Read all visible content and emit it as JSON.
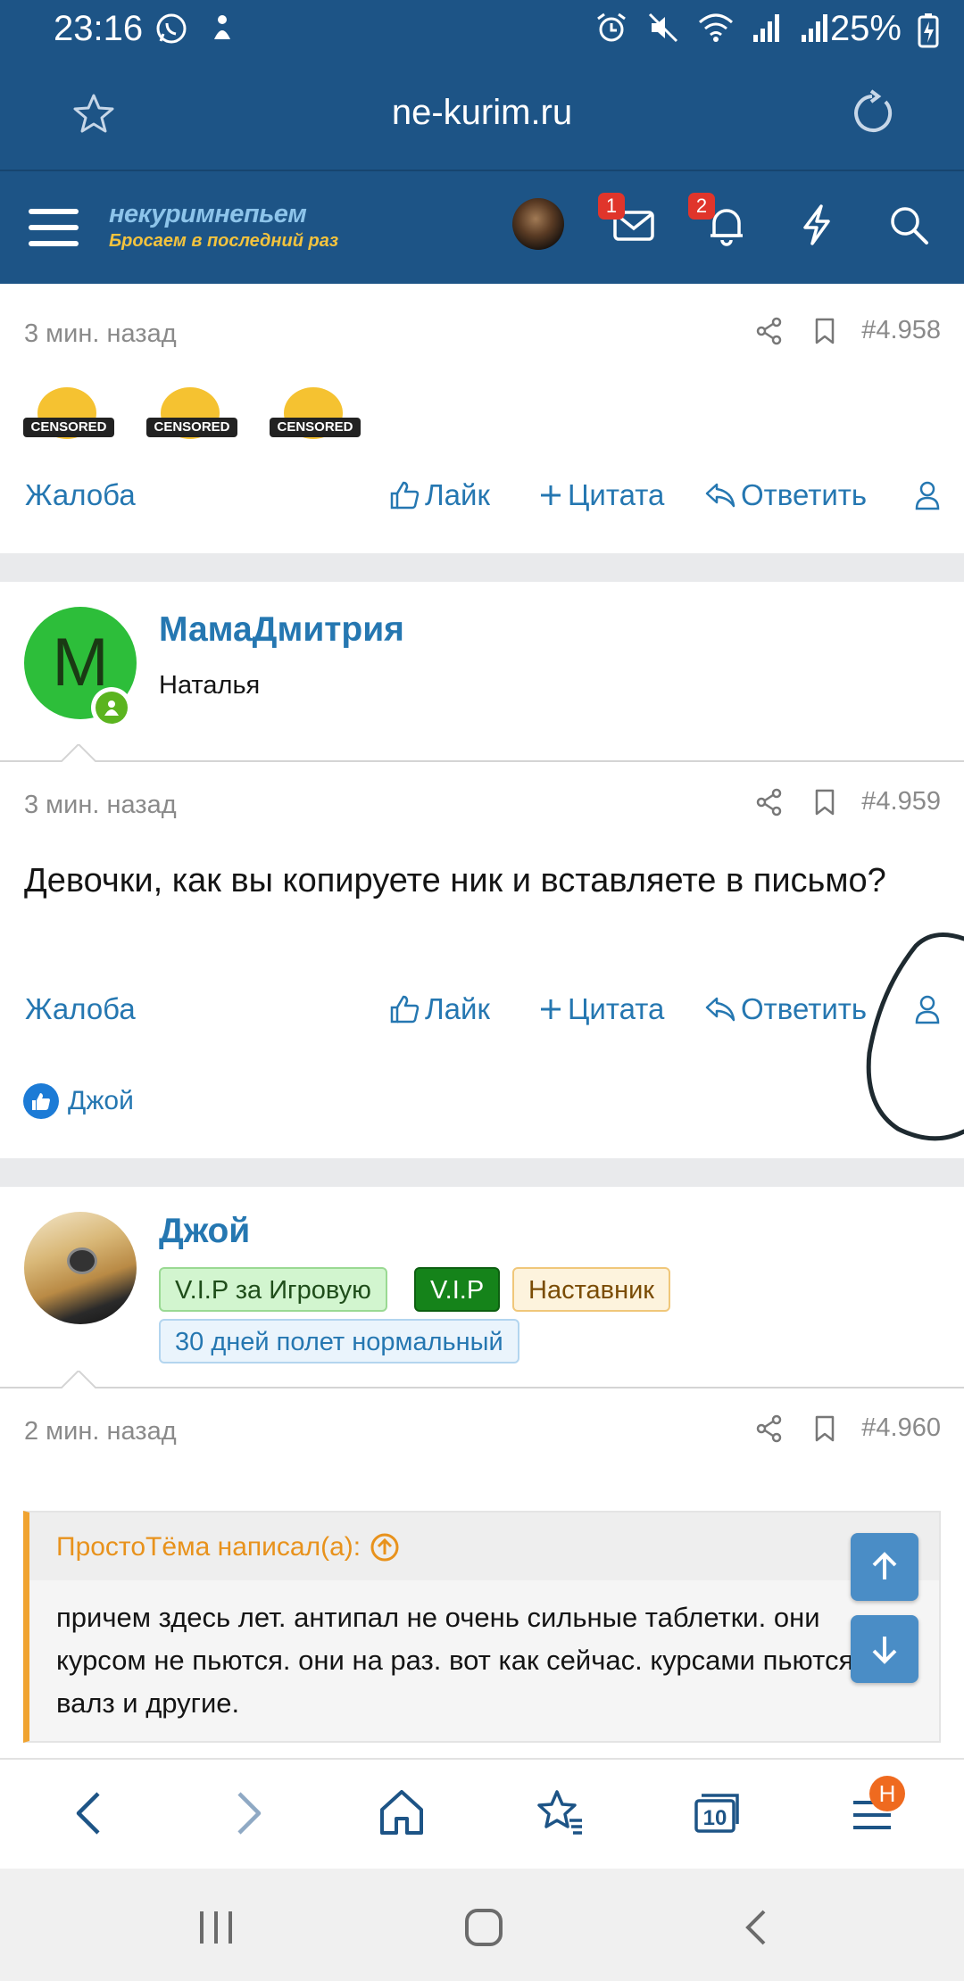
{
  "status_bar": {
    "time": "23:16",
    "battery": "25%"
  },
  "browser": {
    "url": "ne-kurim.ru",
    "tabs_count": "10",
    "menu_badge": "H"
  },
  "site_header": {
    "logo_line1": "некуримнепьем",
    "logo_line2": "Бросаем в последний раз",
    "messages_badge": "1",
    "alerts_badge": "2"
  },
  "posts": [
    {
      "time": "3 мин. назад",
      "number": "#4.958",
      "emoji_label": "CENSORED",
      "actions": {
        "report": "Жалоба",
        "like": "Лайк",
        "quote": "Цитата",
        "reply": "Ответить"
      }
    },
    {
      "author": "МамаДмитрия",
      "avatar_letter": "M",
      "user_title": "Наталья",
      "time": "3 мин. назад",
      "number": "#4.959",
      "text": "Девочки, как вы копируете ник и вставляете в письмо?",
      "actions": {
        "report": "Жалоба",
        "like": "Лайк",
        "quote": "Цитата",
        "reply": "Ответить"
      },
      "liked_by": "Джой"
    },
    {
      "author": "Джой",
      "tags": [
        "V.I.P за Игровую",
        "V.I.P",
        "Наставник",
        "30 дней полет нормальный"
      ],
      "time": "2 мин. назад",
      "number": "#4.960",
      "quote_author": "ПростоТёма написал(а):",
      "quote_text": "причем здесь лет. антипал не очень сильные таблетки. они курсом не пьются. они на раз. вот как сейчас. курсами пьются валз и другие."
    }
  ],
  "colors": {
    "header_bg": "#1d5486",
    "link": "#2577b1",
    "quote_accent": "#f0a330",
    "online_green": "#2dbe3a"
  }
}
